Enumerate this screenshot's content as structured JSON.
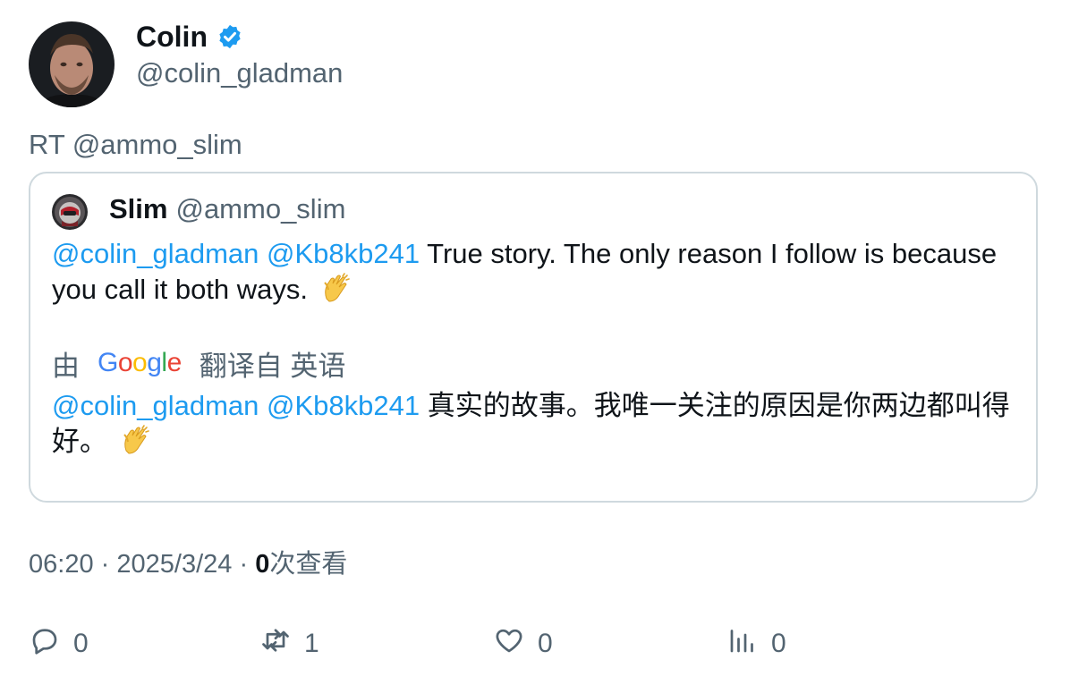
{
  "author": {
    "name": "Colin",
    "handle": "@colin_gladman",
    "verified": true
  },
  "retweet_label": "RT @ammo_slim",
  "quote": {
    "name": "Slim",
    "handle": "@ammo_slim",
    "mentions": [
      "@colin_gladman",
      "@Kb8kb241"
    ],
    "text": "True story. The only reason I follow is because you call it both ways.",
    "emoji": "clapping-hands"
  },
  "translation": {
    "prefix": "由",
    "provider": "Google",
    "suffix": "翻译自 英语",
    "mentions": [
      "@colin_gladman",
      "@Kb8kb241"
    ],
    "text": "真实的故事。我唯一关注的原因是你两边都叫得好。"
  },
  "meta": {
    "time": "06:20",
    "separator": "·",
    "date": "2025/3/24",
    "views_count": "0",
    "views_label": "次查看"
  },
  "actions": {
    "reply_count": "0",
    "retweet_count": "1",
    "like_count": "0",
    "views_count": "0"
  },
  "colors": {
    "accent": "#1d9bf0",
    "text_primary": "#0f1419",
    "text_secondary": "#536471",
    "border": "#cfd9de"
  }
}
